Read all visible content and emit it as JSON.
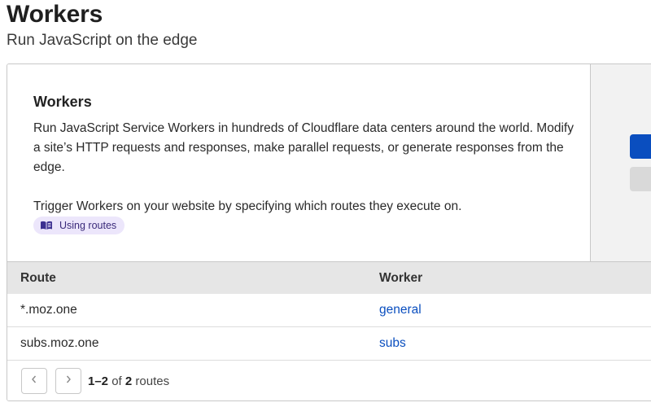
{
  "page": {
    "title": "Workers",
    "subtitle": "Run JavaScript on the edge"
  },
  "card": {
    "heading": "Workers",
    "description": "Run JavaScript Service Workers in hundreds of Cloudflare data centers around the world. Modify a site’s HTTP requests and responses, make parallel requests, or generate responses from the edge.",
    "trigger_text": "Trigger Workers on your website by specifying which routes they execute on.",
    "doc_link_label": "Using routes",
    "doc_link_icon": "book-icon"
  },
  "side_actions": {
    "primary_color": "#0a4ebf",
    "secondary_color": "#d9d9d9"
  },
  "routes_table": {
    "columns": [
      "Route",
      "Worker"
    ],
    "rows": [
      {
        "route": "*.moz.one",
        "worker": "general"
      },
      {
        "route": "subs.moz.one",
        "worker": "subs"
      }
    ]
  },
  "pagination": {
    "range": "1–2",
    "of_label": "of",
    "total": "2",
    "unit": "routes",
    "prev_icon": "chevron-left-icon",
    "next_icon": "chevron-right-icon"
  },
  "colors": {
    "link": "#0a4ebf",
    "header_bg": "#e6e6e6",
    "pill_bg": "#ece6fb"
  }
}
